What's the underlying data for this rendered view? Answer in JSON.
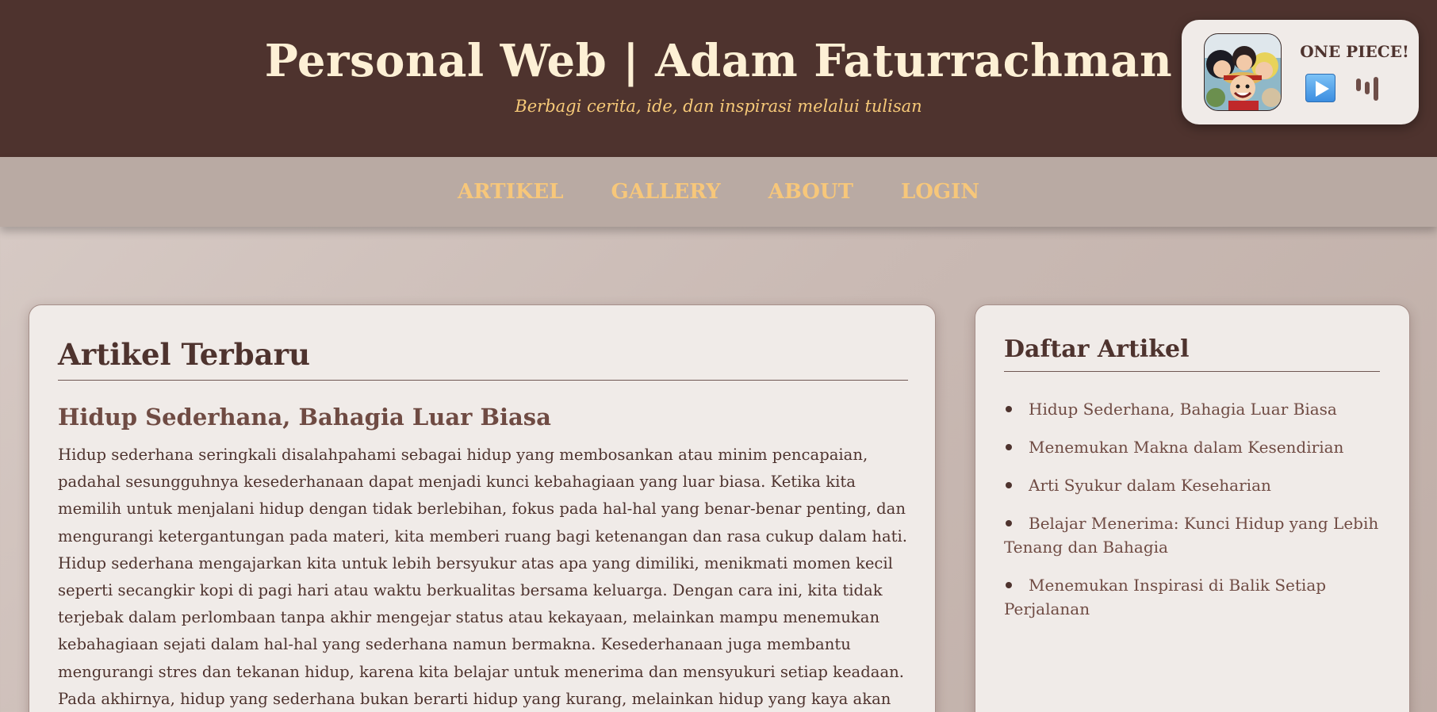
{
  "header": {
    "title": "Personal Web | Adam Faturrachman",
    "tagline": "Berbagi cerita, ide, dan inspirasi melalui tulisan"
  },
  "music_player": {
    "track": "ONE PIECE!",
    "icons": [
      "album-art",
      "play-icon",
      "equalizer-icon"
    ]
  },
  "nav": {
    "items": [
      "ARTIKEL",
      "GALLERY",
      "ABOUT",
      "LOGIN"
    ]
  },
  "main": {
    "heading": "Artikel Terbaru",
    "article_title": "Hidup Sederhana, Bahagia Luar Biasa",
    "article_body": "Hidup sederhana seringkali disalahpahami sebagai hidup yang membosankan atau minim pencapaian, padahal sesungguhnya kesederhanaan dapat menjadi kunci kebahagiaan yang luar biasa. Ketika kita memilih untuk menjalani hidup dengan tidak berlebihan, fokus pada hal-hal yang benar-benar penting, dan mengurangi ketergantungan pada materi, kita memberi ruang bagi ketenangan dan rasa cukup dalam hati. Hidup sederhana mengajarkan kita untuk lebih bersyukur atas apa yang dimiliki, menikmati momen kecil seperti secangkir kopi di pagi hari atau waktu berkualitas bersama keluarga. Dengan cara ini, kita tidak terjebak dalam perlombaan tanpa akhir mengejar status atau kekayaan, melainkan mampu menemukan kebahagiaan sejati dalam hal-hal yang sederhana namun bermakna. Kesederhanaan juga membantu mengurangi stres dan tekanan hidup, karena kita belajar untuk menerima dan mensyukuri setiap keadaan. Pada akhirnya, hidup yang sederhana bukan berarti hidup yang kurang, melainkan hidup yang kaya akan makna, kedamaian, dan kebahagiaan yang hakiki."
  },
  "sidebar": {
    "heading": "Daftar Artikel",
    "items": [
      "Hidup Sederhana, Bahagia Luar Biasa",
      "Menemukan Makna dalam Kesendirian",
      "Arti Syukur dalam Keseharian",
      "Belajar Menerima: Kunci Hidup yang Lebih Tenang dan Bahagia",
      "Menemukan Inspirasi di Balik Setiap Perjalanan"
    ]
  },
  "colors": {
    "header_bg": "#4e332e",
    "title_color": "#fdf0d5",
    "tagline_color": "#f6c978",
    "nav_bg": "#b9aaa3",
    "nav_link": "#f7c77a",
    "card_bg": "#f0ebe8",
    "text_dark": "#4e332e",
    "text_accent": "#6f4b43"
  }
}
